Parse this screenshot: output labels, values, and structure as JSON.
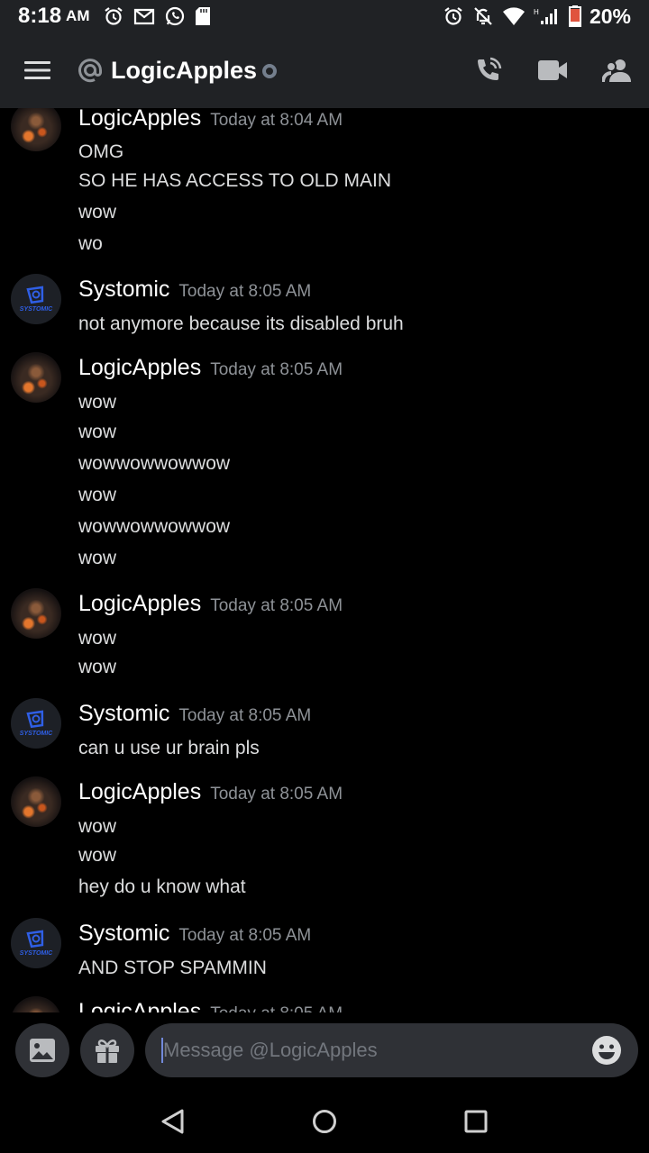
{
  "status_bar": {
    "time": "8:18",
    "ampm": "AM",
    "battery": "20%",
    "left_icons": [
      "alarm-icon",
      "gmail-icon",
      "whatsapp-icon",
      "sd-card-icon"
    ],
    "right_icons": [
      "alarm-icon",
      "mute-icon",
      "wifi-icon",
      "signal-icon",
      "battery-icon"
    ]
  },
  "header": {
    "title": "LogicApples",
    "icons": [
      "menu-icon",
      "at-icon",
      "offline-status-icon",
      "call-icon",
      "video-icon",
      "members-icon"
    ]
  },
  "messages": [
    {
      "author": "LogicApples",
      "avatar": "logicapples",
      "time": "Today at 8:04 AM",
      "lines": [
        "OMG",
        "SO HE HAS ACCESS TO OLD MAIN",
        "wow",
        "wo"
      ]
    },
    {
      "author": "Systomic",
      "avatar": "systomic",
      "time": "Today at 8:05 AM",
      "lines": [
        "not anymore because its disabled bruh"
      ]
    },
    {
      "author": "LogicApples",
      "avatar": "logicapples",
      "time": "Today at 8:05 AM",
      "lines": [
        "wow",
        "wow",
        "wowwowwowwow",
        "wow",
        "wowwowwowwow",
        "wow"
      ]
    },
    {
      "author": "LogicApples",
      "avatar": "logicapples",
      "time": "Today at 8:05 AM",
      "lines": [
        "wow",
        "wow"
      ]
    },
    {
      "author": "Systomic",
      "avatar": "systomic",
      "time": "Today at 8:05 AM",
      "lines": [
        "can u use ur brain pls"
      ]
    },
    {
      "author": "LogicApples",
      "avatar": "logicapples",
      "time": "Today at 8:05 AM",
      "lines": [
        "wow",
        "wow",
        "hey do u know what"
      ]
    },
    {
      "author": "Systomic",
      "avatar": "systomic",
      "time": "Today at 8:05 AM",
      "lines": [
        "AND STOP SPAMMIN"
      ]
    },
    {
      "author": "LogicApples",
      "avatar": "logicapples",
      "time": "Today at 8:05 AM",
      "lines": []
    }
  ],
  "systomic_avatar_text": "SYSTOMIC",
  "composer": {
    "placeholder": "Message @LogicApples",
    "icons": [
      "image-icon",
      "gift-icon",
      "emoji-icon"
    ]
  },
  "nav": {
    "icons": [
      "back-icon",
      "home-icon",
      "recents-icon"
    ]
  },
  "colors": {
    "background": "#000000",
    "header": "#202225",
    "input": "#2f3136",
    "timestamp": "#8e9297",
    "accent": "#7289da"
  }
}
